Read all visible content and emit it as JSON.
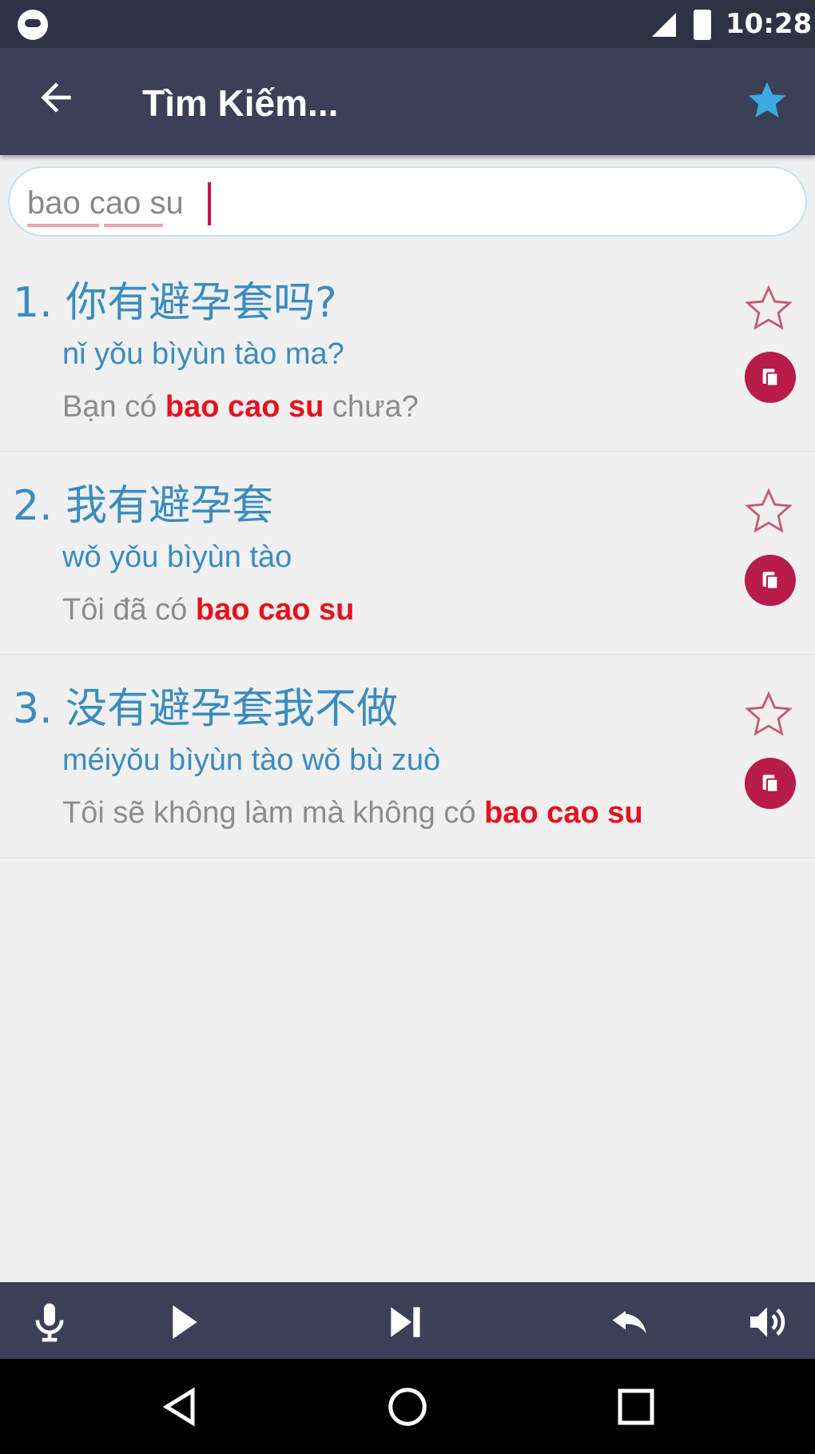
{
  "status_bar": {
    "time": "10:28"
  },
  "app_bar": {
    "title": "Tìm Kiếm..."
  },
  "search": {
    "value": "bao cao su"
  },
  "results": [
    {
      "chinese": "1. 你有避孕套吗?",
      "pinyin": "nǐ yǒu bìyùn tào ma?",
      "viet_before": "Bạn có ",
      "viet_highlight": "bao cao su",
      "viet_after": " chưa?"
    },
    {
      "chinese": "2. 我有避孕套",
      "pinyin": "wǒ yǒu bìyùn tào",
      "viet_before": "Tôi đã có ",
      "viet_highlight": "bao cao su",
      "viet_after": ""
    },
    {
      "chinese": "3. 没有避孕套我不做",
      "pinyin": "méiyǒu bìyùn tào wǒ bù zuò",
      "viet_before": "Tôi sẽ không làm mà không có ",
      "viet_highlight": "bao cao su",
      "viet_after": ""
    }
  ],
  "colors": {
    "app_bar": "#3c3f58",
    "status_bar": "#2f3245",
    "accent_blue": "#3a8cc0",
    "highlight_red": "#e8101e",
    "copy_button": "#b71c4b",
    "favorite_star": "#3da9e3"
  },
  "icons": {
    "app_bar": [
      "back-arrow-icon",
      "favorite-star-icon"
    ],
    "result_actions": [
      "star-outline-icon",
      "copy-icon"
    ],
    "bottom_bar": [
      "microphone-icon",
      "play-icon",
      "skip-next-icon",
      "replay-icon",
      "volume-icon"
    ],
    "nav_bar": [
      "nav-back-icon",
      "nav-home-icon",
      "nav-recents-icon"
    ]
  }
}
